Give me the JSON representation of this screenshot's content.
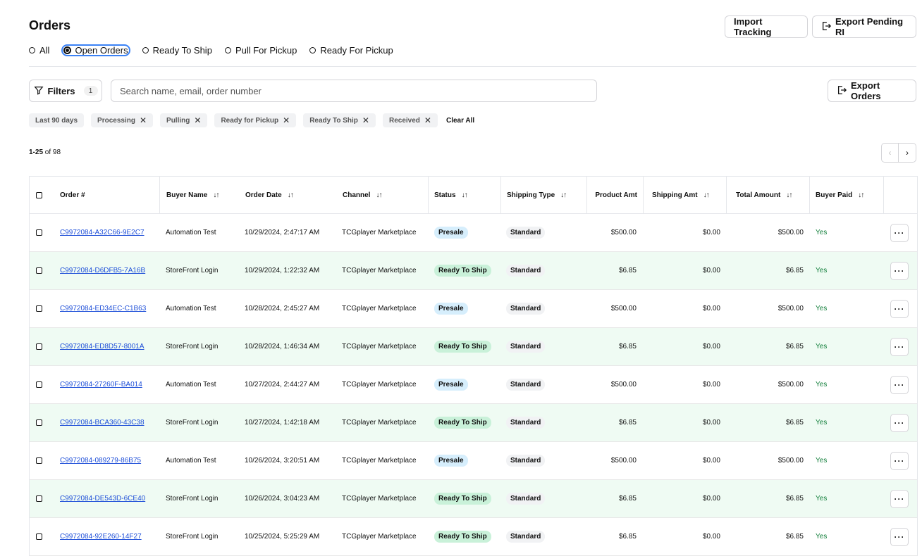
{
  "page": {
    "title": "Orders"
  },
  "header_actions": {
    "import_tracking": "Import Tracking",
    "export_pending": "Export Pending RI"
  },
  "radio_filters": [
    {
      "label": "All",
      "selected": false
    },
    {
      "label": "Open Orders",
      "selected": true
    },
    {
      "label": "Ready To Ship",
      "selected": false
    },
    {
      "label": "Pull For Pickup",
      "selected": false
    },
    {
      "label": "Ready For Pickup",
      "selected": false
    }
  ],
  "toolbar": {
    "filters_label": "Filters",
    "filters_count": "1",
    "search_placeholder": "Search name, email, order number",
    "export_orders": "Export Orders"
  },
  "chips": {
    "date": "Last 90 days",
    "statuses": [
      "Processing",
      "Pulling",
      "Ready for Pickup",
      "Ready To Ship",
      "Received"
    ],
    "clear_all": "Clear All"
  },
  "pagination": {
    "range": "1-25",
    "of_label": "of 98"
  },
  "table": {
    "headers": {
      "order": "Order #",
      "buyer": "Buyer Name",
      "date": "Order Date",
      "channel": "Channel",
      "status": "Status",
      "shipping_type": "Shipping Type",
      "product_amt": "Product Amt",
      "shipping_amt": "Shipping Amt",
      "total": "Total Amount",
      "buyer_paid": "Buyer Paid"
    },
    "rows": [
      {
        "order": "C9972084-A32C66-9E2C7",
        "buyer": "Automation Test",
        "date": "10/29/2024, 2:47:17 AM",
        "channel": "TCGplayer Marketplace",
        "status": "Presale",
        "shipping_type": "Standard",
        "product_amt": "$500.00",
        "shipping_amt": "$0.00",
        "total": "$500.00",
        "buyer_paid": "Yes"
      },
      {
        "order": "C9972084-D6DFB5-7A16B",
        "buyer": "StoreFront Login",
        "date": "10/29/2024, 1:22:32 AM",
        "channel": "TCGplayer Marketplace",
        "status": "Ready To Ship",
        "shipping_type": "Standard",
        "product_amt": "$6.85",
        "shipping_amt": "$0.00",
        "total": "$6.85",
        "buyer_paid": "Yes"
      },
      {
        "order": "C9972084-ED34EC-C1B63",
        "buyer": "Automation Test",
        "date": "10/28/2024, 2:45:27 AM",
        "channel": "TCGplayer Marketplace",
        "status": "Presale",
        "shipping_type": "Standard",
        "product_amt": "$500.00",
        "shipping_amt": "$0.00",
        "total": "$500.00",
        "buyer_paid": "Yes"
      },
      {
        "order": "C9972084-ED8D57-8001A",
        "buyer": "StoreFront Login",
        "date": "10/28/2024, 1:46:34 AM",
        "channel": "TCGplayer Marketplace",
        "status": "Ready To Ship",
        "shipping_type": "Standard",
        "product_amt": "$6.85",
        "shipping_amt": "$0.00",
        "total": "$6.85",
        "buyer_paid": "Yes"
      },
      {
        "order": "C9972084-27260F-BA014",
        "buyer": "Automation Test",
        "date": "10/27/2024, 2:44:27 AM",
        "channel": "TCGplayer Marketplace",
        "status": "Presale",
        "shipping_type": "Standard",
        "product_amt": "$500.00",
        "shipping_amt": "$0.00",
        "total": "$500.00",
        "buyer_paid": "Yes"
      },
      {
        "order": "C9972084-BCA360-43C38",
        "buyer": "StoreFront Login",
        "date": "10/27/2024, 1:42:18 AM",
        "channel": "TCGplayer Marketplace",
        "status": "Ready To Ship",
        "shipping_type": "Standard",
        "product_amt": "$6.85",
        "shipping_amt": "$0.00",
        "total": "$6.85",
        "buyer_paid": "Yes"
      },
      {
        "order": "C9972084-089279-86B75",
        "buyer": "Automation Test",
        "date": "10/26/2024, 3:20:51 AM",
        "channel": "TCGplayer Marketplace",
        "status": "Presale",
        "shipping_type": "Standard",
        "product_amt": "$500.00",
        "shipping_amt": "$0.00",
        "total": "$500.00",
        "buyer_paid": "Yes"
      },
      {
        "order": "C9972084-DE543D-6CE40",
        "buyer": "StoreFront Login",
        "date": "10/26/2024, 3:04:23 AM",
        "channel": "TCGplayer Marketplace",
        "status": "Ready To Ship",
        "shipping_type": "Standard",
        "product_amt": "$6.85",
        "shipping_amt": "$0.00",
        "total": "$6.85",
        "buyer_paid": "Yes"
      },
      {
        "order": "C9972084-92E260-14F27",
        "buyer": "StoreFront Login",
        "date": "10/25/2024, 5:25:29 AM",
        "channel": "TCGplayer Marketplace",
        "status": "Ready To Ship",
        "shipping_type": "Standard",
        "product_amt": "$6.85",
        "shipping_amt": "$0.00",
        "total": "$6.85",
        "buyer_paid": "Yes"
      }
    ]
  }
}
